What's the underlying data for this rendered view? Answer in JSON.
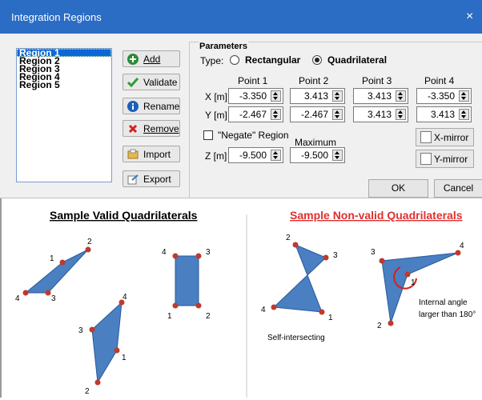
{
  "window": {
    "title": "Integration Regions",
    "close_glyph": "×"
  },
  "regions": {
    "items": [
      "Region 1",
      "Region 2",
      "Region 3",
      "Region 4",
      "Region 5"
    ],
    "selected": "Region 1"
  },
  "buttons": {
    "add": "Add",
    "validate": "Validate",
    "rename": "Rename",
    "remove": "Remove",
    "import": "Import",
    "export": "Export"
  },
  "parameters": {
    "group_label": "Parameters",
    "type_label": "Type:",
    "type_options": [
      "Rectangular",
      "Quadrilateral"
    ],
    "type_selected": "Quadrilateral",
    "point_headers": [
      "Point 1",
      "Point 2",
      "Point 3",
      "Point 4"
    ],
    "x_label": "X [m]",
    "y_label": "Y [m]",
    "z_label": "Z [m]",
    "x_values": [
      "-3.350",
      "3.413",
      "3.413",
      "-3.350"
    ],
    "y_values": [
      "-2.467",
      "-2.467",
      "3.413",
      "3.413"
    ],
    "negate_label": "\"Negate\" Region",
    "negate_checked": false,
    "maximum_label": "Maximum",
    "z_values": [
      "-9.500",
      "-9.500"
    ],
    "xmirror_label": "X-mirror",
    "ymirror_label": "Y-mirror"
  },
  "dialog": {
    "ok": "OK",
    "cancel": "Cancel"
  },
  "figure": {
    "valid_title": "Sample Valid Quadrilaterals",
    "invalid_title": "Sample Non-valid Quadrilaterals",
    "self_intersecting": "Self-intersecting",
    "internal_angle_line1": "Internal angle",
    "internal_angle_line2": "larger than 180°",
    "vertex_labels": [
      "1",
      "2",
      "3",
      "4"
    ]
  },
  "colors": {
    "titlebar": "#2b6cc4",
    "selection": "#0a68d8",
    "shape_fill": "#4a7fc1",
    "vertex": "#c0392b",
    "invalid_title": "#e03030"
  }
}
